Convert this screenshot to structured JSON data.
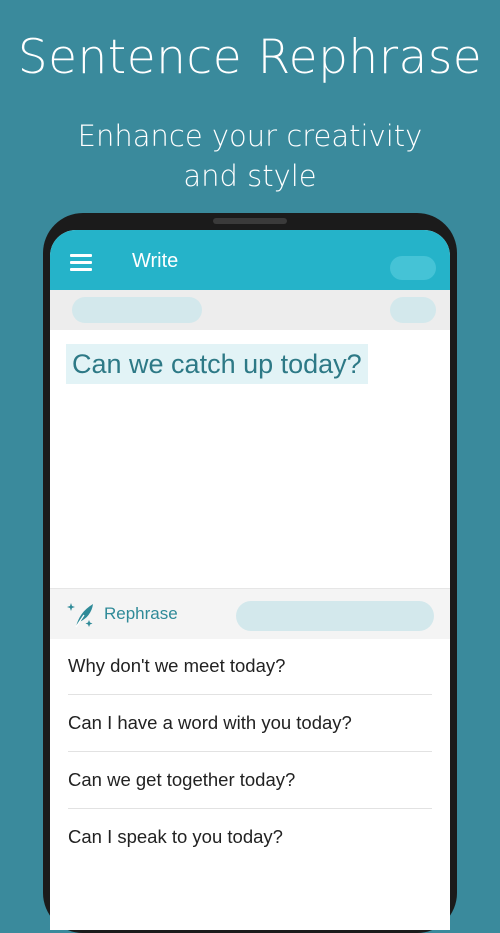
{
  "promo": {
    "headline": "Sentence Rephrase",
    "tagline_line1": "Enhance your creativity",
    "tagline_line2": "and style"
  },
  "appbar": {
    "title": "Write",
    "menu_icon": "hamburger-menu-icon"
  },
  "editor": {
    "text": "Can we catch up today?"
  },
  "rephrase": {
    "label": "Rephrase",
    "icon": "quill-sparkle-icon",
    "suggestions": [
      "Why don't we meet today?",
      "Can I have a word with you today?",
      "Can we get together today?",
      "Can I speak to you today?"
    ]
  },
  "colors": {
    "background": "#3a8a9c",
    "appbar": "#25b3c9",
    "accent_text": "#2d7986",
    "highlight": "#e2f3f6"
  }
}
